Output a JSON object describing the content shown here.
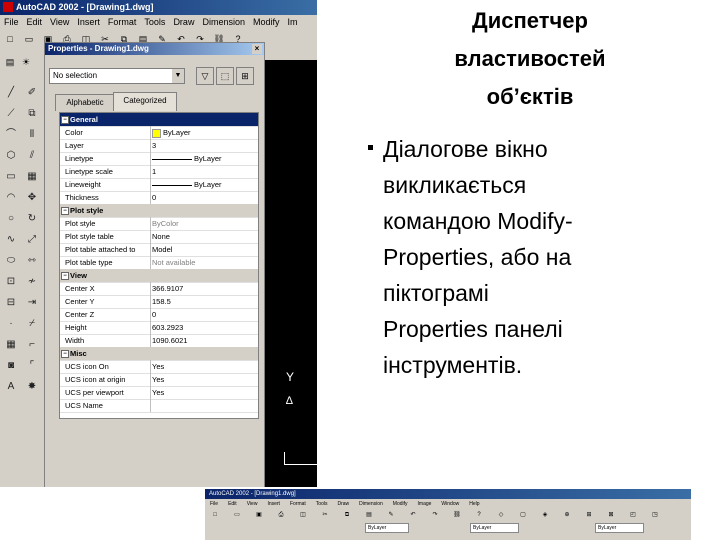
{
  "heading": {
    "lines": [
      "Диспетчер",
      "властивостей",
      "об’єктів"
    ]
  },
  "body_text": {
    "lines": [
      "Діалогове вікно",
      "викликається",
      "командою Modify-",
      "Properties, або на",
      "піктограмі",
      "Properties панелі",
      "інструментів."
    ]
  },
  "acad": {
    "title": "AutoCAD 2002 - [Drawing1.dwg]",
    "menu": [
      "File",
      "Edit",
      "View",
      "Insert",
      "Format",
      "Tools",
      "Draw",
      "Dimension",
      "Modify",
      "Im"
    ],
    "ucs_y": "Y",
    "ucs_triangle": "∆"
  },
  "properties": {
    "title": "Properties - Drawing1.dwg",
    "close": "×",
    "selection": "No selection",
    "tabs": [
      "Alphabetic",
      "Categorized"
    ],
    "rows": [
      {
        "type": "cat",
        "label": "General",
        "selected": true
      },
      {
        "label": "Color",
        "value": "ByLayer",
        "swatch": true
      },
      {
        "label": "Layer",
        "value": "3"
      },
      {
        "label": "Linetype",
        "value": "ByLayer",
        "line": true
      },
      {
        "label": "Linetype scale",
        "value": "1"
      },
      {
        "label": "Lineweight",
        "value": "ByLayer",
        "line": true
      },
      {
        "label": "Thickness",
        "value": "0"
      },
      {
        "type": "cat",
        "label": "Plot style"
      },
      {
        "label": "Plot style",
        "value": "ByColor",
        "gray": true
      },
      {
        "label": "Plot style table",
        "value": "None"
      },
      {
        "label": "Plot table attached to",
        "value": "Model"
      },
      {
        "label": "Plot table type",
        "value": "Not available",
        "gray": true
      },
      {
        "type": "cat",
        "label": "View"
      },
      {
        "label": "Center X",
        "value": "366.9107"
      },
      {
        "label": "Center Y",
        "value": "158.5"
      },
      {
        "label": "Center Z",
        "value": "0"
      },
      {
        "label": "Height",
        "value": "603.2923"
      },
      {
        "label": "Width",
        "value": "1090.6021"
      },
      {
        "type": "cat",
        "label": "Misc"
      },
      {
        "label": "UCS icon On",
        "value": "Yes"
      },
      {
        "label": "UCS icon at origin",
        "value": "Yes"
      },
      {
        "label": "UCS per viewport",
        "value": "Yes"
      },
      {
        "label": "UCS Name",
        "value": ""
      }
    ]
  },
  "thumb": {
    "title": "AutoCAD 2002 - [Drawing1.dwg]",
    "menu": [
      "File",
      "Edit",
      "View",
      "Insert",
      "Format",
      "Tools",
      "Draw",
      "Dimension",
      "Modify",
      "Image",
      "Window",
      "Help"
    ],
    "combo_left": "ByLayer",
    "combo_mid": "ByLayer",
    "combo_right": "ByLayer"
  },
  "icons": {
    "top_toolbar": [
      "new-icon",
      "open-icon",
      "save-icon",
      "print-icon",
      "preview-icon",
      "cut-icon",
      "copy-icon",
      "paste-icon",
      "matchprop-icon",
      "undo-icon",
      "redo-icon",
      "link-icon",
      "help-icon"
    ],
    "props_buttons": [
      "quick-select-icon",
      "select-objects-icon",
      "toggle-pickadd-icon"
    ]
  }
}
